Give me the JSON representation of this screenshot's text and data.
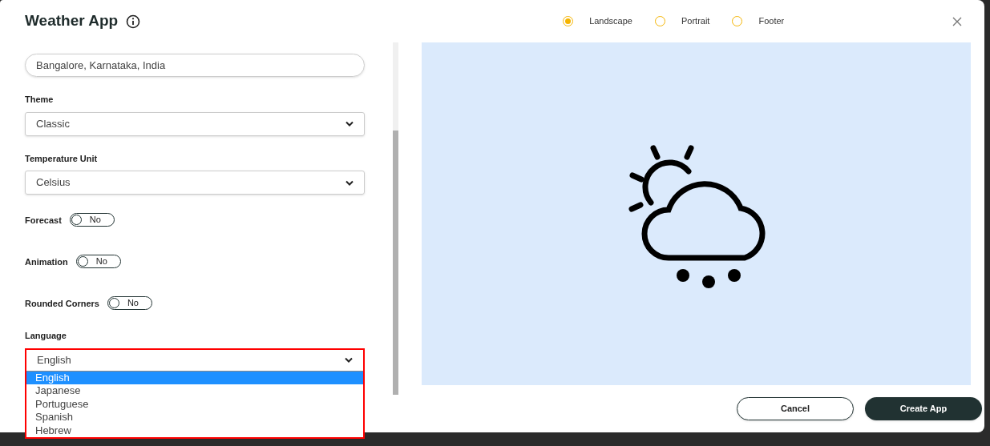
{
  "title": "Weather App",
  "orientations": [
    {
      "label": "Landscape",
      "selected": true
    },
    {
      "label": "Portrait",
      "selected": false
    },
    {
      "label": "Footer",
      "selected": false
    }
  ],
  "location": {
    "value": "Bangalore, Karnataka, India"
  },
  "fields": [
    {
      "kind": "select",
      "label": "Theme",
      "value": "Classic"
    },
    {
      "kind": "select",
      "label": "Temperature Unit",
      "value": "Celsius"
    },
    {
      "kind": "toggle",
      "label": "Forecast",
      "on": false,
      "text": "No"
    },
    {
      "kind": "toggle",
      "label": "Animation",
      "on": false,
      "text": "No"
    },
    {
      "kind": "toggle",
      "label": "Rounded Corners",
      "on": false,
      "text": "No"
    },
    {
      "kind": "dropdown",
      "label": "Language",
      "value": "English",
      "expanded": true,
      "options": [
        {
          "label": "English",
          "selected": true
        },
        {
          "label": "Japanese",
          "selected": false
        },
        {
          "label": "Portuguese",
          "selected": false
        },
        {
          "label": "Spanish",
          "selected": false
        },
        {
          "label": "Hebrew",
          "selected": false
        }
      ]
    }
  ],
  "buttons": [
    {
      "kind": "secondary",
      "label": "Cancel"
    },
    {
      "kind": "primary",
      "label": "Create App"
    }
  ]
}
